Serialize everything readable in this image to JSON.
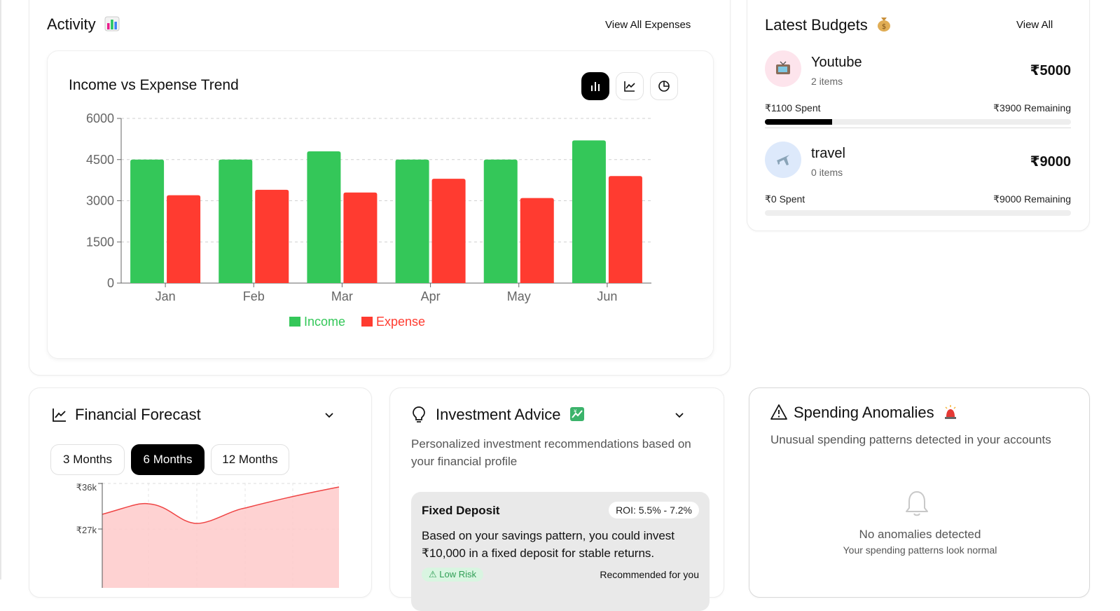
{
  "activity": {
    "title": "Activity",
    "view_all_label": "View All Expenses",
    "chart_title": "Income vs Expense Trend",
    "chart_buttons": [
      {
        "name": "bar-chart-icon",
        "active": true
      },
      {
        "name": "line-chart-icon",
        "active": false
      },
      {
        "name": "pie-chart-icon",
        "active": false
      }
    ]
  },
  "chart_data": {
    "type": "bar",
    "title": "Income vs Expense Trend",
    "categories": [
      "Jan",
      "Feb",
      "Mar",
      "Apr",
      "May",
      "Jun"
    ],
    "series": [
      {
        "name": "Income",
        "values": [
          4500,
          4500,
          4800,
          4500,
          4500,
          5200
        ],
        "color": "#34c759"
      },
      {
        "name": "Expense",
        "values": [
          3200,
          3400,
          3300,
          3800,
          3100,
          3900
        ],
        "color": "#ff3b30"
      }
    ],
    "ylim": [
      0,
      6000
    ],
    "yticks": [
      0,
      1500,
      3000,
      4500,
      6000
    ],
    "grid": true,
    "legend": "bottom-center",
    "xlabel": "",
    "ylabel": ""
  },
  "budgets": {
    "title": "Latest Budgets",
    "view_all_label": "View All",
    "items": [
      {
        "name": "Youtube",
        "items_text": "2 items",
        "amount": "₹5000",
        "spent": "₹1100 Spent",
        "remaining": "₹3900 Remaining",
        "progress": 0.22,
        "icon": "tv-icon",
        "icon_bg": "#fde4ec"
      },
      {
        "name": "travel",
        "items_text": "0 items",
        "amount": "₹9000",
        "spent": "₹0 Spent",
        "remaining": "₹9000 Remaining",
        "progress": 0.0,
        "icon": "airplane-icon",
        "icon_bg": "#dde9fb"
      }
    ]
  },
  "forecast": {
    "title": "Financial Forecast",
    "tabs": [
      {
        "label": "3 Months",
        "active": false
      },
      {
        "label": "6 Months",
        "active": true
      },
      {
        "label": "12 Months",
        "active": false
      }
    ],
    "y_tick_labels": [
      "₹36k",
      "₹27k"
    ]
  },
  "investment": {
    "title": "Investment Advice",
    "description": "Personalized investment recommendations based on your financial profile",
    "advice": {
      "title": "Fixed Deposit",
      "roi": "ROI: 5.5% - 7.2%",
      "text": "Based on your savings pattern, you could invest ₹10,000 in a fixed deposit for stable returns.",
      "risk": "Low Risk",
      "note": "Recommended for you"
    }
  },
  "anomalies": {
    "title": "Spending Anomalies",
    "description": "Unusual spending patterns detected in your accounts",
    "empty_title": "No anomalies detected",
    "empty_sub": "Your spending patterns look normal"
  },
  "colors": {
    "income": "#34c759",
    "expense": "#ff3b30",
    "forecast_line": "#ef4444",
    "forecast_fill": "#fecaca"
  }
}
